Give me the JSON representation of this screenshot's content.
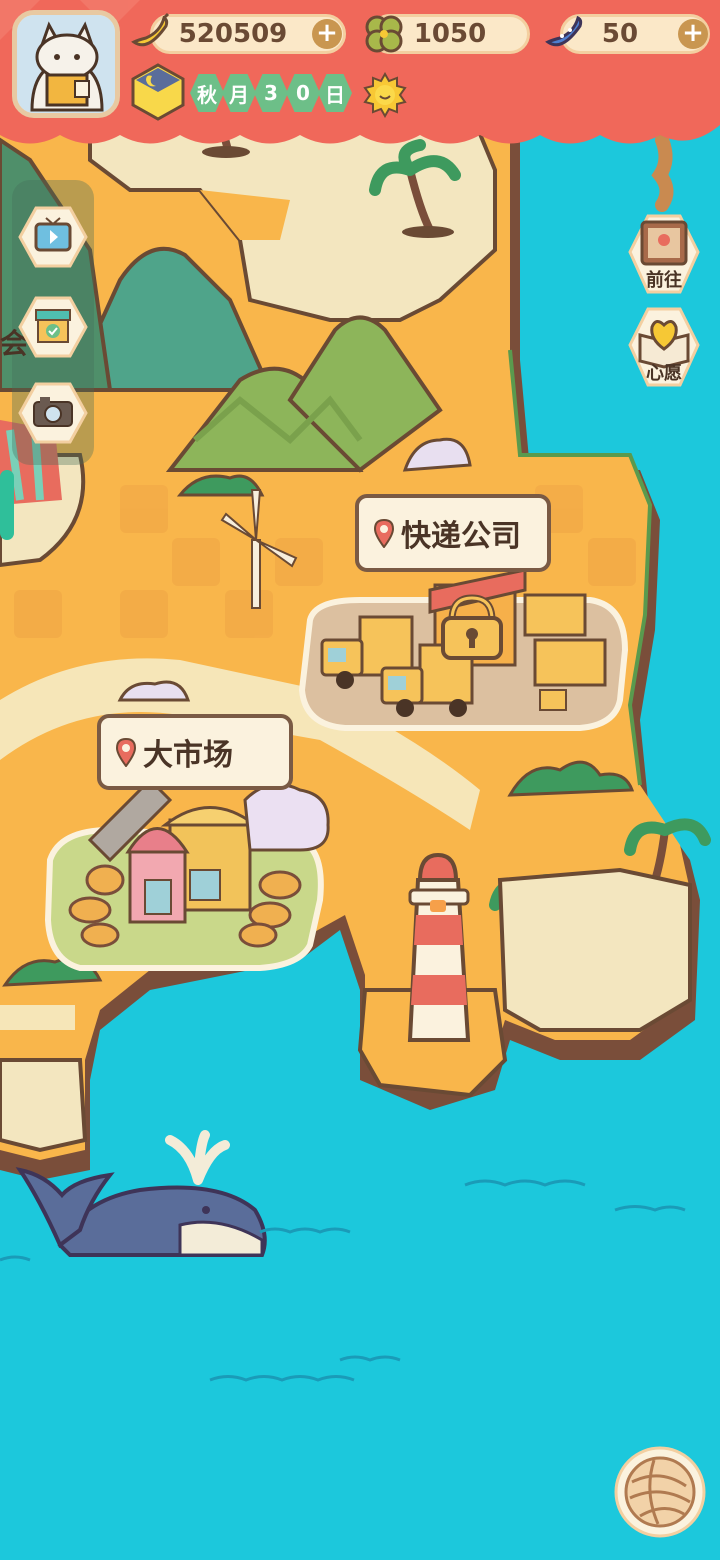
{
  "resources": {
    "banana": {
      "value": "520509",
      "icon": "banana-icon"
    },
    "clover": {
      "value": "1050",
      "icon": "clover-icon"
    },
    "blue_banana": {
      "value": "50",
      "icon": "blue-banana-icon"
    },
    "plus_label": "+"
  },
  "date": {
    "chars": [
      "秋",
      "月",
      "3",
      "0",
      "日"
    ]
  },
  "side_buttons": {
    "goto": {
      "label": "前往",
      "icon": "noticeboard-icon"
    },
    "wish": {
      "label": "心愿",
      "icon": "heart-book-icon"
    }
  },
  "left_buttons": [
    {
      "icon": "tv-icon"
    },
    {
      "icon": "shop-stall-icon"
    },
    {
      "icon": "camera-icon"
    }
  ],
  "left_partial_label": "会",
  "locations": {
    "express": {
      "label": "快递公司",
      "locked": true
    },
    "market": {
      "label": "大市场"
    }
  },
  "colors": {
    "sea": "#1cc8dc",
    "land": "#f9b64b",
    "sand": "#f3e6bf",
    "hud_red": "#f0685a",
    "outline": "#6a4a34"
  }
}
